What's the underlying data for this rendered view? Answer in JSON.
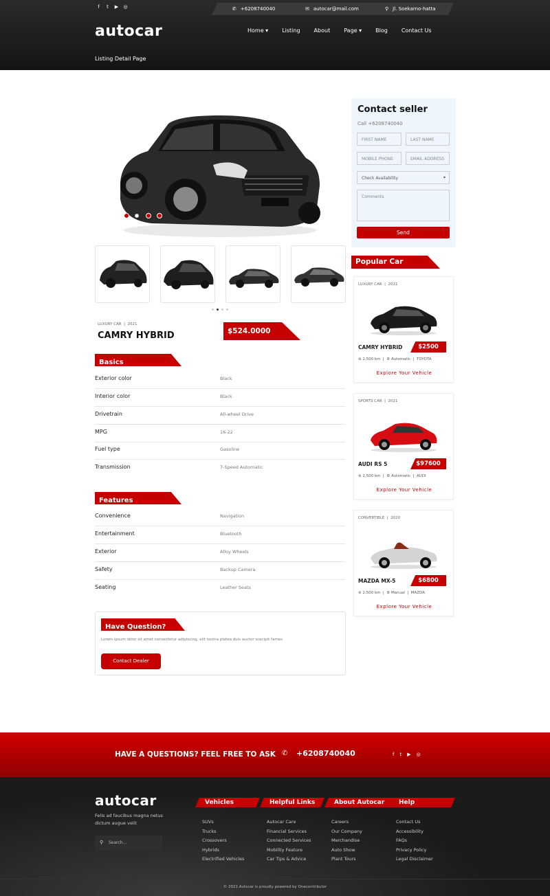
{
  "header": {
    "social_icons": [
      "facebook-icon",
      "twitter-icon",
      "youtube-icon",
      "instagram-icon"
    ],
    "phone": "+6208740040",
    "email": "autocar@mail.com",
    "address": "Jl. Soekarno-hatta",
    "logo": "autocar",
    "nav": [
      "Home",
      "Listing",
      "About",
      "Page",
      "Blog",
      "Contact Us"
    ],
    "breadcrumb": "Listing Detail Page"
  },
  "listing": {
    "category": "LUXURY CAR",
    "year": "2021",
    "name": "CAMRY HYBRID",
    "price": "$524.0000"
  },
  "basics": {
    "title": "Basics",
    "rows": [
      {
        "k": "Exterior color",
        "v": "Black"
      },
      {
        "k": "Interior color",
        "v": "Black"
      },
      {
        "k": "Drivetrain",
        "v": "All-wheel Drive"
      },
      {
        "k": "MPG",
        "v": "16-22"
      },
      {
        "k": "Fuel type",
        "v": "Gasoline"
      },
      {
        "k": "Transmission",
        "v": "7-Speed Automatic"
      }
    ]
  },
  "features": {
    "title": "Features",
    "rows": [
      {
        "k": "Convenience",
        "v": "Navigation"
      },
      {
        "k": "Entertainment",
        "v": "Bluetooth"
      },
      {
        "k": "Exterior",
        "v": "Alloy Wheels"
      },
      {
        "k": "Safety",
        "v": "Backup Camera"
      },
      {
        "k": "Seating",
        "v": "Leather Seats"
      }
    ]
  },
  "question": {
    "title": "Have Question?",
    "text": "Lorem ipsum dolor sit amet consectetur adipiscing, elit nostra platea duis auctor suscipit fames",
    "button": "Contact Dealer"
  },
  "contact": {
    "title": "Contact seller",
    "call": "Call +6208740040",
    "first_name": "FIRST NAME",
    "last_name": "LAST NAME",
    "mobile": "MOBILE PHONE",
    "email": "EMAIL ADDRESS",
    "select": "Check Availability",
    "comments": "Comments",
    "send": "Send"
  },
  "popular": {
    "title": "Popular Car",
    "cars": [
      {
        "category": "LUXURY CAR",
        "year": "2021",
        "name": "CAMRY HYBRID",
        "price": "$2500",
        "km": "2,500 km",
        "trans": "Automatic",
        "brand": "TOYOTA",
        "link": "Explore Your Vehicle",
        "color": "#1b1b1b"
      },
      {
        "category": "SPORTS CAR",
        "year": "2021",
        "name": "AUDI RS 5",
        "price": "$97600",
        "km": "2,500 km",
        "trans": "Automatic",
        "brand": "AUDI",
        "link": "Explore Your Vehicle",
        "color": "#d80d14"
      },
      {
        "category": "CONVERTIBLE",
        "year": "2020",
        "name": "MAZDA MX-5",
        "price": "$6800",
        "km": "2,500 km",
        "trans": "Manual",
        "brand": "MAZDA",
        "link": "Explore Your Vehicle",
        "color": "#cfcfcf"
      }
    ]
  },
  "cta": {
    "text": "HAVE A QUESTIONS? FEEL FREE TO ASK",
    "phone": "+6208740040"
  },
  "footer": {
    "logo": "autocar",
    "tagline": "Felis ad faucibus magna netus dictum augue velit",
    "search_placeholder": "Search...",
    "columns": [
      {
        "title": "Vehicles",
        "links": [
          "SUVs",
          "Trucks",
          "Crossovers",
          "Hybrids",
          "Electrified Vehicles"
        ]
      },
      {
        "title": "Helpful Links",
        "links": [
          "Autocar Care",
          "Financial Services",
          "Connected Services",
          "Mobility Feature",
          "Car Tips & Advice"
        ]
      },
      {
        "title": "About Autocar",
        "links": [
          "Careers",
          "Our Company",
          "Merchandise",
          "Auto Show",
          "Plant Tours"
        ]
      },
      {
        "title": "Help",
        "links": [
          "Contact Us",
          "Accessibility",
          "FAQs",
          "Privacy Policy",
          "Legal Disclaimer"
        ]
      }
    ],
    "copyright": "© 2021 Autocar is proudly powered by Onecontributor"
  },
  "colors": {
    "accent": "#c50000",
    "dark": "#1b1b1b"
  }
}
